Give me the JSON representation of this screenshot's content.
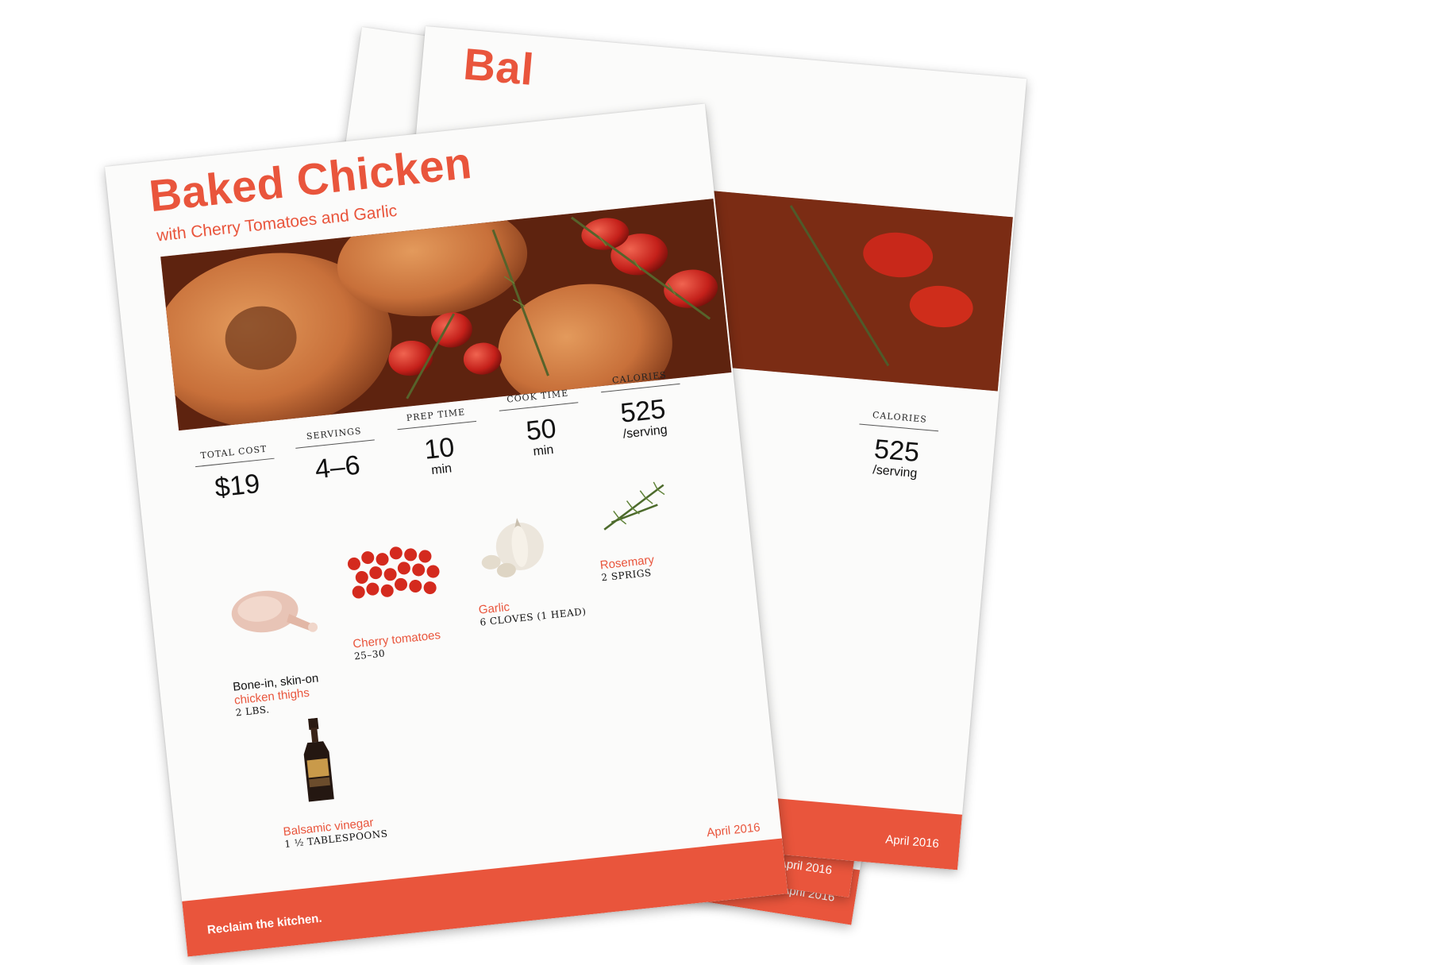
{
  "colors": {
    "accent": "#e9553c",
    "paper": "#fbfbfa",
    "text": "#111111"
  },
  "background_sheets": [
    {
      "title_fragment": "Bal",
      "date": "April 2016",
      "footer_fragment": "pril 2016"
    },
    {
      "date": "April 2016"
    },
    {
      "date": "April 2016"
    }
  ],
  "partial_stats": {
    "label": "CALORIES",
    "value": "525",
    "unit": "/serving"
  },
  "flyer": {
    "title": "Baked Chicken",
    "subtitle": "with Cherry Tomatoes and Garlic",
    "stats": [
      {
        "label": "TOTAL COST",
        "value": "$19",
        "unit": ""
      },
      {
        "label": "SERVINGS",
        "value": "4–6",
        "unit": ""
      },
      {
        "label": "PREP TIME",
        "value": "10",
        "unit": "min"
      },
      {
        "label": "COOK TIME",
        "value": "50",
        "unit": "min"
      },
      {
        "label": "CALORIES",
        "value": "525",
        "unit": "/serving"
      }
    ],
    "ingredients": [
      {
        "pre": "Bone-in, skin-on",
        "name": "chicken thighs",
        "qty": "2 LBS.",
        "icon": "chicken-thigh-image"
      },
      {
        "name": "Cherry tomatoes",
        "qty": "25–30",
        "icon": "cherry-tomatoes-image"
      },
      {
        "name": "Garlic",
        "qty": "6 CLOVES (1 HEAD)",
        "icon": "garlic-image"
      },
      {
        "name": "Rosemary",
        "qty": "2 SPRIGS",
        "icon": "rosemary-image"
      },
      {
        "name": "Balsamic vinegar",
        "qty": "1 ½ TABLESPOONS",
        "icon": "balsamic-bottle-image"
      }
    ],
    "date": "April 2016",
    "tagline": "Reclaim the kitchen."
  }
}
